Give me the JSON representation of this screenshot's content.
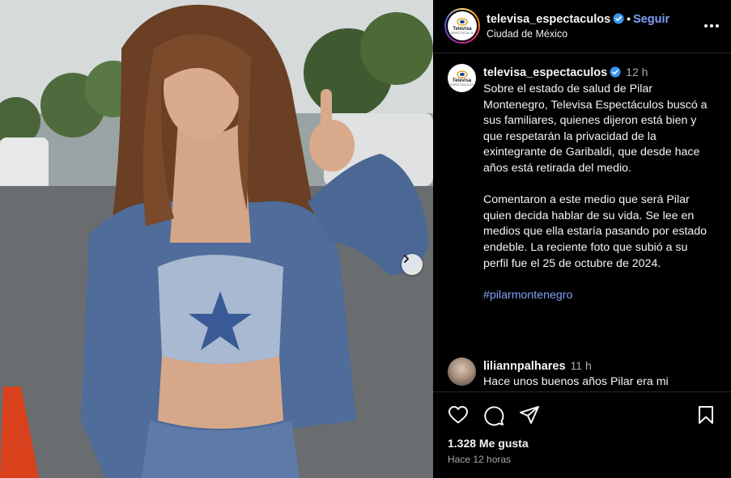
{
  "post": {
    "username": "televisa_espectaculos",
    "follow_label": "Seguir",
    "location": "Ciudad de México",
    "avatar_brand": "Televisa",
    "avatar_sub": "ESPECTÁCULOS"
  },
  "caption": {
    "username": "televisa_espectaculos",
    "time": "12 h",
    "paragraph1": "Sobre el estado de salud de Pilar Montenegro, Televisa Espectáculos buscó a sus familiares, quienes dijeron está bien y que respetarán la privacidad de la exintegrante de Garibaldi, que desde hace años está retirada del medio.",
    "paragraph2": "Comentaron a este medio que será Pilar quien decida hablar de su vida. Se lee en medios que ella estaría pasando por estado endeble. La reciente foto que subió a su perfil fue el 25 de octubre de 2024.",
    "hashtag": "#pilarmontenegro"
  },
  "comment": {
    "username": "liliannpalhares",
    "time": "11 h",
    "text": "Hace unos buenos años Pilar era mi"
  },
  "stats": {
    "likes": "1.328 Me gusta",
    "posted_ago": "Hace 12 horas"
  },
  "icons": {
    "verified": "verified-badge-icon",
    "more": "more-options-icon",
    "like": "heart-icon",
    "comment": "comment-icon",
    "share": "share-icon",
    "save": "bookmark-icon",
    "next": "chevron-right-icon"
  },
  "colors": {
    "accent_link": "#7ea2f7",
    "verified": "#3897f0",
    "background": "#000000",
    "muted_text": "#a8a8a8"
  }
}
